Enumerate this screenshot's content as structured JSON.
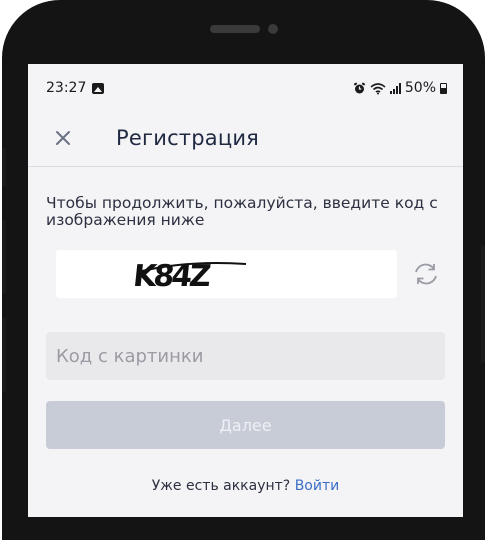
{
  "statusbar": {
    "time": "23:27",
    "battery": "50%"
  },
  "header": {
    "title": "Регистрация"
  },
  "captcha": {
    "prompt": "Чтобы продолжить, пожалуйста, введите код с изображения ниже",
    "image_text": "K84Z"
  },
  "form": {
    "code_placeholder": "Код с картинки",
    "code_value": "",
    "next_label": "Далее"
  },
  "footer": {
    "have_account": "Уже есть аккаунт?",
    "login_link": "Войти"
  },
  "icons": {
    "close": "close-icon",
    "refresh": "refresh-icon",
    "gallery": "image-icon",
    "alarm": "alarm-icon",
    "wifi": "wifi-icon",
    "signal": "signal-icon",
    "battery": "battery-icon"
  },
  "colors": {
    "link": "#3a6ec6",
    "title": "#1f2942",
    "button_disabled": "#c8ccd6"
  }
}
